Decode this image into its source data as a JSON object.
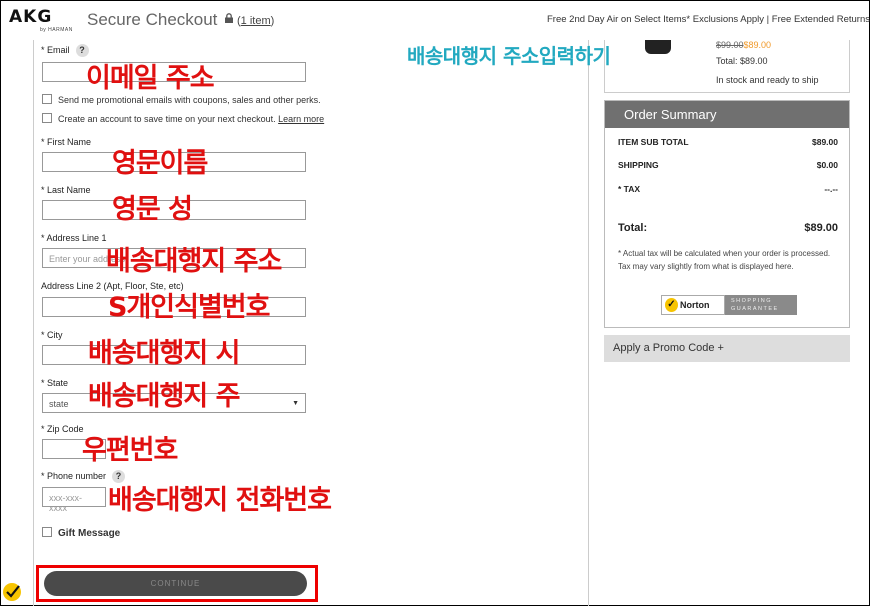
{
  "header": {
    "logo": "AKG",
    "logo_sub": "by HARMAN",
    "title": "Secure Checkout",
    "items_prefix": "(",
    "items_link": "1 item",
    "items_suffix": ")",
    "promo": "Free 2nd Day Air on Select Items* Exclusions Apply | Free Extended Returns"
  },
  "form": {
    "email_label": "* Email",
    "promo_email_text": "Send me promotional emails with coupons, sales and other perks.",
    "account_text": "Create an account to save time on your next checkout.",
    "learn_more": "Learn more",
    "first_name_label": "* First Name",
    "last_name_label": "* Last Name",
    "address1_label": "* Address Line 1",
    "address1_placeholder": "Enter your address",
    "address2_label": "Address Line 2 (Apt, Floor, Ste, etc)",
    "city_label": "* City",
    "state_label": "* State",
    "state_value": "state",
    "zip_label": "* Zip Code",
    "phone_label": "* Phone number",
    "phone_placeholder": "xxx-xxx-xxxx",
    "gift_label": "Gift Message",
    "continue": "CONTINUE"
  },
  "annotations": {
    "email": "이메일 주소",
    "first_name": "영문이름",
    "last_name": "영문 성",
    "address1": "배송대행지 주소",
    "address2": "S개인식별번호",
    "city": "배송대행지 시",
    "state": "배송대행지 주",
    "zip": "우편번호",
    "phone": "배송대행지 전화번호",
    "headline": "배송대행지 주소입력하기"
  },
  "product": {
    "old_price": "$99.00",
    "new_price": "$89.00",
    "total": "Total: $89.00",
    "stock": "In stock and ready to ship"
  },
  "summary": {
    "title": "Order Summary",
    "rows": [
      {
        "label": "ITEM SUB TOTAL",
        "value": "$89.00"
      },
      {
        "label": "SHIPPING",
        "value": "$0.00"
      },
      {
        "label": "* TAX",
        "value": "--.--"
      }
    ],
    "total_label": "Total:",
    "total_value": "$89.00",
    "note": "* Actual tax will be calculated when your order is processed. Tax may vary slightly from what is displayed here.",
    "norton": "Norton",
    "norton_guarantee_1": "SHOPPING",
    "norton_guarantee_2": "GUARANTEE"
  },
  "promo_code": "Apply a Promo Code +",
  "colors": {
    "annotation_red": "#e01010",
    "annotation_teal": "#22a9c0",
    "highlight_box": "#ee0000",
    "summary_header": "#707070"
  }
}
